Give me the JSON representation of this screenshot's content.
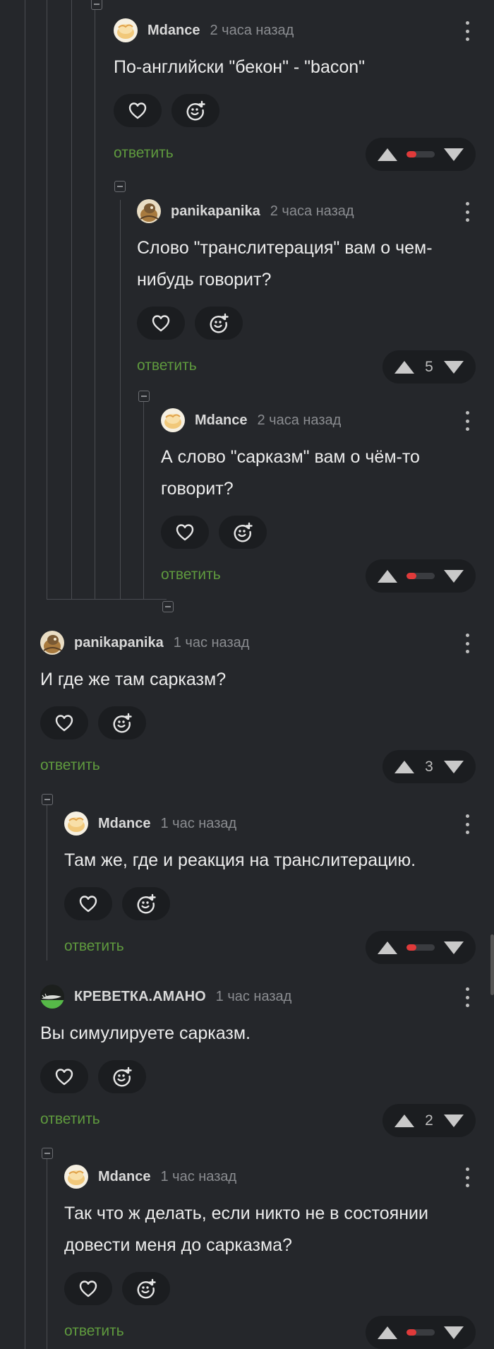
{
  "reply_label": "ответить",
  "colors": {
    "background": "#25272b",
    "reply": "#5f9a3e",
    "ratio_red": "#e03a3a"
  },
  "comments": [
    {
      "author": "Mdance",
      "time": "2 часа назад",
      "text": "По-английски \"бекон\" - \"bacon\"",
      "score": ""
    },
    {
      "author": "panikapanika",
      "time": "2 часа назад",
      "text": "Слово \"транслитерация\" вам о чем-нибудь говорит?",
      "score": "5"
    },
    {
      "author": "Mdance",
      "time": "2 часа назад",
      "text": "А слово \"сарказм\" вам о чём-то говорит?",
      "score": ""
    },
    {
      "author": "panikapanika",
      "time": "1 час назад",
      "text": "И где же там сарказм?",
      "score": "3"
    },
    {
      "author": "Mdance",
      "time": "1 час назад",
      "text": "Там же, где и реакция на транслитерацию.",
      "score": ""
    },
    {
      "author": "КРЕВЕТКА.АМАНО",
      "time": "1 час назад",
      "text": "Вы симулируете сарказм.",
      "score": "2"
    },
    {
      "author": "Mdance",
      "time": "1 час назад",
      "text": "Так что ж делать, если никто не в состоянии довести меня до сарказма?",
      "score": ""
    }
  ]
}
